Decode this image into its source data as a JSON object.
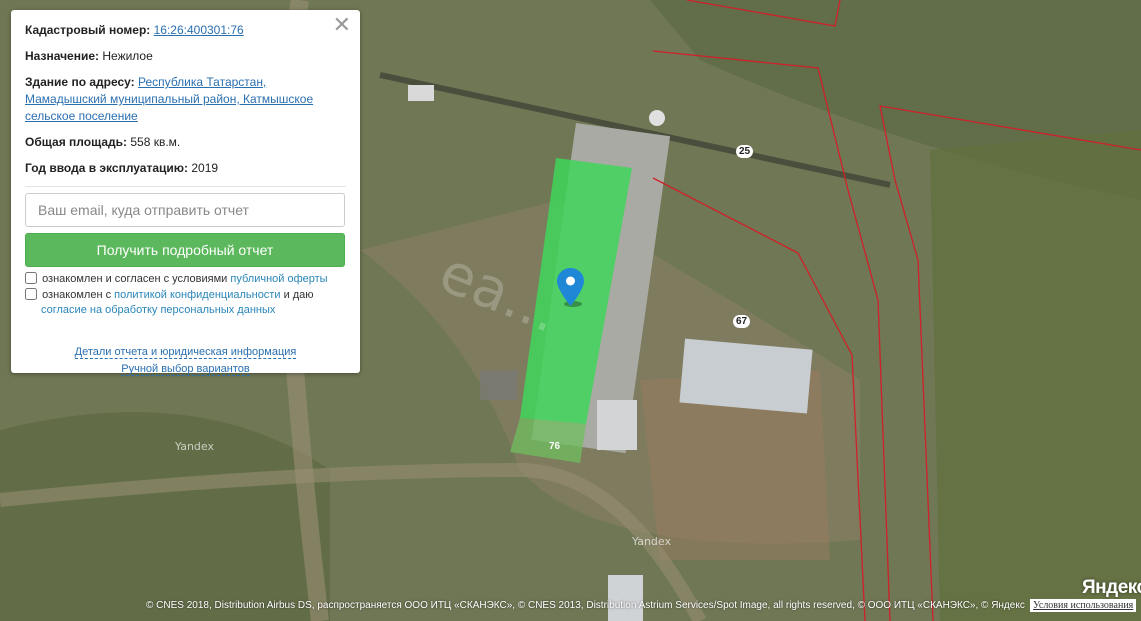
{
  "card": {
    "close_icon": "close-icon",
    "cadastral": {
      "label": "Кадастровый номер:",
      "value": "16:26:400301:76"
    },
    "purpose": {
      "label": "Назначение:",
      "value": "Нежилое"
    },
    "address": {
      "label": "Здание по адресу:",
      "value": "Республика Татарстан, Мамадышский муниципальный район, Катмышское сельское поселение"
    },
    "area": {
      "label": "Общая площадь:",
      "value": "558 кв.м."
    },
    "year": {
      "label": "Год ввода в эксплуатацию:",
      "value": "2019"
    },
    "email_placeholder": "Ваш email, куда отправить отчет",
    "report_button": "Получить подробный отчет",
    "consent1": {
      "text": "ознакомлен и согласен с условиями",
      "link": "публичной оферты"
    },
    "consent2": {
      "text_before": "ознакомлен с",
      "link1": "политикой конфиденциальности",
      "text_mid": "и даю",
      "link2": "согласие на обработку персональных данных"
    },
    "details_link": "Детали отчета и юридическая информация",
    "manual_link": "Ручной выбор вариантов"
  },
  "map": {
    "parcel_labels": [
      "25",
      "67",
      "76"
    ],
    "yandex_labels": [
      "Yandex",
      "Yandex"
    ],
    "watermark": "ea...",
    "copyright": "© CNES 2018, Distribution Airbus DS, распространяется ООО ИТЦ «СКАНЭКС», © CNES 2013, Distribution Astrium Services/Spot Image, all rights reserved, © ООО ИТЦ «СКАНЭКС», © Яндекс",
    "terms_link": "Условия использования",
    "logo": "Яндекс",
    "colors": {
      "parcel_fill": "#3fd65a",
      "boundary": "#d0202a",
      "marker": "#1e88d6"
    }
  }
}
